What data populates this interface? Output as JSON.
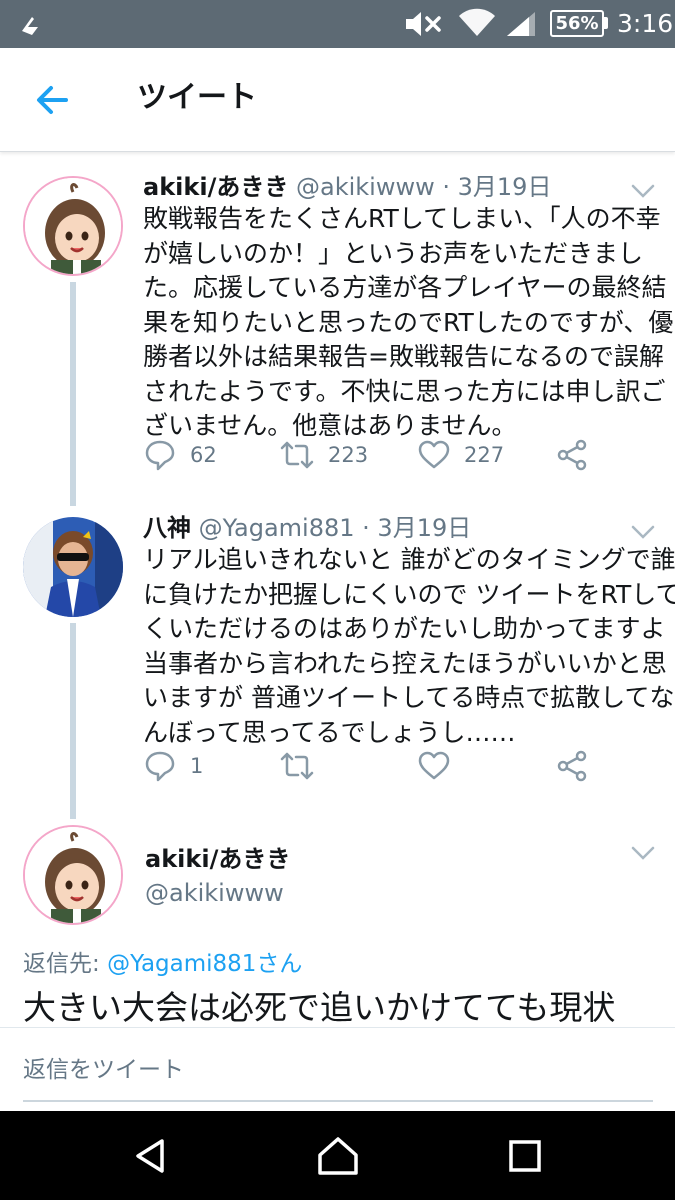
{
  "status_bar": {
    "battery": "56%",
    "time": "3:16"
  },
  "header": {
    "title": "ツイート"
  },
  "tweets": [
    {
      "name": "akiki/あきき",
      "handle": "@akikiwww",
      "separator": "·",
      "date": "3月19日",
      "lines": [
        "敗戦報告をたくさんRTしてしまい、「人の不幸",
        "が嬉しいのか！」というお声をいただきまし",
        "た。応援している方達が各プレイヤーの最終結",
        "果を知りたいと思ったのでRTしたのですが、優",
        "勝者以外は結果報告=敗戦報告になるので誤解",
        "されたようです。不快に思った方には申し訳ご",
        "ざいません。他意はありません。"
      ],
      "replies": "62",
      "retweets": "223",
      "likes": "227"
    },
    {
      "name": "八神",
      "handle": "@Yagami881",
      "separator": "·",
      "date": "3月19日",
      "lines": [
        "リアル追いきれないと 誰がどのタイミングで誰",
        "に負けたか把握しにくいので ツイートをRTして",
        "くいただけるのはありがたいし助かってますよ",
        "当事者から言われたら控えたほうがいいかと思",
        "いますが 普通ツイートしてる時点で拡散してな",
        "んぼって思ってるでしょうし……"
      ],
      "replies": "1",
      "retweets": "",
      "likes": ""
    }
  ],
  "focused_tweet": {
    "name": "akiki/あきき",
    "handle": "@akikiwww",
    "reply_prefix": "返信先:",
    "reply_mention": "@Yagami881さん",
    "text": "大きい大会は必死で追いかけてても現状"
  },
  "reply_bar": {
    "placeholder": "返信をツイート"
  },
  "colors": {
    "accent": "#1da1f2",
    "status_bar": "#5d6a74",
    "thread_line": "#c9d7e1",
    "secondary_text": "#657786"
  },
  "icons": {
    "back": "arrow-left-icon",
    "reply": "speech-bubble-icon",
    "retweet": "retweet-arrows-icon",
    "like": "heart-icon",
    "share": "share-nodes-icon",
    "more": "chevron-down-icon"
  }
}
